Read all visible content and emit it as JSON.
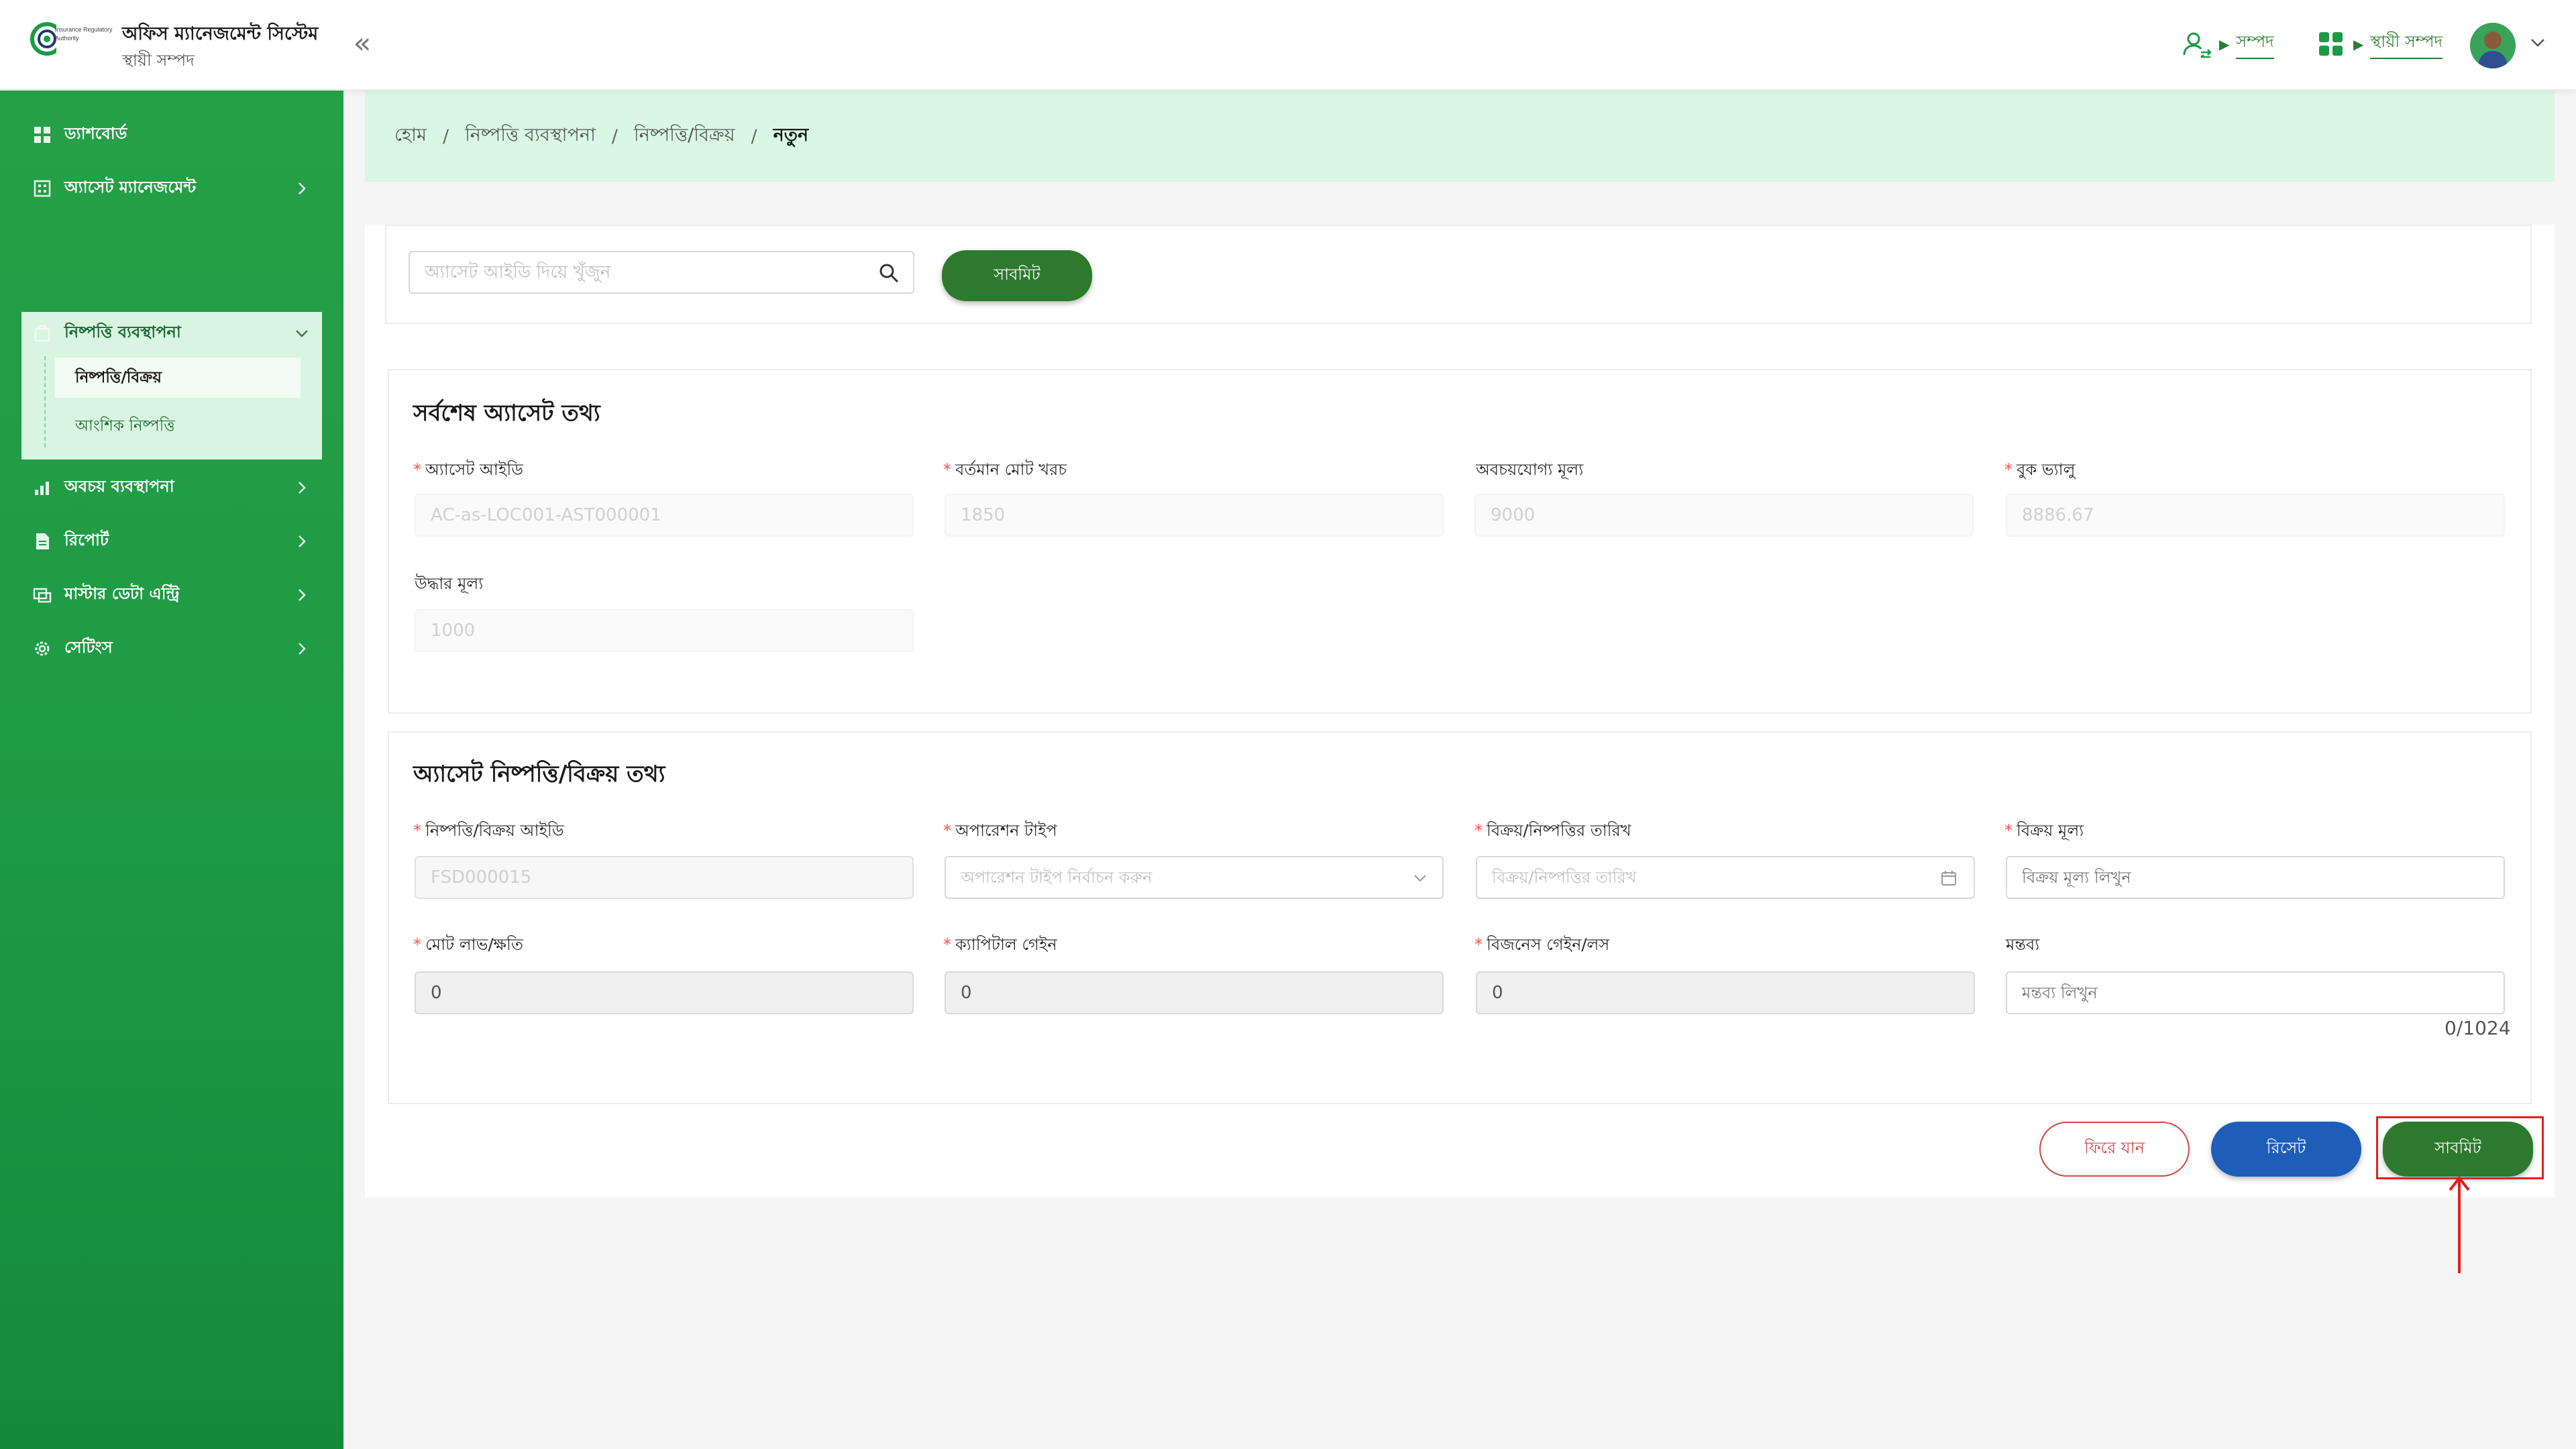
{
  "header": {
    "logo_text": "Insurance Regulatory Authority",
    "app_title": "অফিস ম্যানেজমেন্ট সিস্টেম",
    "app_subtitle": "স্থায়ী সম্পদ",
    "collapse_glyph": "«",
    "link1_label": "সম্পদ",
    "link2_label": "স্থায়ী সম্পদ",
    "link1_icon": "user-switch-icon",
    "link2_icon": "apps-grid-icon"
  },
  "sidebar": {
    "items": [
      {
        "label": "ড্যাশবোর্ড",
        "icon": "dashboard-icon"
      },
      {
        "label": "অ্যাসেট ম্যানেজমেন্ট",
        "icon": "building-icon"
      },
      {
        "label": "নিষ্পত্তি ব্যবস্থাপনা",
        "icon": "disposal-icon"
      },
      {
        "label": "অবচয় ব্যবস্থাপনা",
        "icon": "depreciation-icon"
      },
      {
        "label": "রিপোর্ট",
        "icon": "report-icon"
      },
      {
        "label": "মাস্টার ডেটা এন্ট্রি",
        "icon": "master-data-icon"
      },
      {
        "label": "সেটিংস",
        "icon": "settings-icon"
      }
    ],
    "sub_items": [
      {
        "label": "নিষ্পত্তি/বিক্রয়"
      },
      {
        "label": "আংশিক নিষ্পত্তি"
      }
    ]
  },
  "breadcrumb": {
    "items": [
      "হোম",
      "নিষ্পত্তি ব্যবস্থাপনা",
      "নিষ্পত্তি/বিক্রয়"
    ],
    "current": "নতুন",
    "separator": "/"
  },
  "search": {
    "placeholder": "অ্যাসেট আইডি দিয়ে খুঁজুন",
    "submit_label": "সাবমিট"
  },
  "latest_asset": {
    "title": "সর্বশেষ অ্যাসেট তথ্য",
    "fields": [
      {
        "label": "অ্যাসেট আইডি",
        "required": true,
        "value": "AC-as-LOC001-AST000001"
      },
      {
        "label": "বর্তমান মোট খরচ",
        "required": true,
        "value": "1850"
      },
      {
        "label": "অবচয়যোগ্য মূল্য",
        "required": false,
        "value": "9000"
      },
      {
        "label": "বুক ভ্যালু",
        "required": true,
        "value": "8886.67"
      },
      {
        "label": "উদ্ধার মূল্য",
        "required": false,
        "value": "1000"
      }
    ]
  },
  "disposal": {
    "title": "অ্যাসেট নিষ্পত্তি/বিক্রয় তথ্য",
    "disposal_id": {
      "label": "নিষ্পত্তি/বিক্রয় আইডি",
      "required": true,
      "value": "FSD000015"
    },
    "operation_type": {
      "label": "অপারেশন টাইপ",
      "required": true,
      "placeholder": "অপারেশন টাইপ নির্বাচন করুন"
    },
    "date": {
      "label": "বিক্রয়/নিষ্পত্তির তারিখ",
      "required": true,
      "placeholder": "বিক্রয়/নিষ্পত্তির তারিখ"
    },
    "sale_price": {
      "label": "বিক্রয় মূল্য",
      "required": true,
      "placeholder": "বিক্রয় মূল্য লিখুন"
    },
    "total_profit_loss": {
      "label": "মোট লাভ/ক্ষতি",
      "required": true,
      "value": "0"
    },
    "capital_gain": {
      "label": "ক্যাপিটাল গেইন",
      "required": true,
      "value": "0"
    },
    "business_gain_loss": {
      "label": "বিজনেস গেইন/লস",
      "required": true,
      "value": "0"
    },
    "comment": {
      "label": "মন্তব্য",
      "required": false,
      "placeholder": "মন্তব্য লিখুন",
      "counter": "0/1024"
    }
  },
  "actions": {
    "back_label": "ফিরে যান",
    "reset_label": "রিসেট",
    "submit_label": "সাবমিট"
  },
  "colors": {
    "primary_green": "#2d7a2e",
    "sidebar_green": "#1d9a45",
    "breadcrumb_bg": "#d9f7e3",
    "reset_blue": "#1e5eb8",
    "back_red": "#d64545",
    "highlight_red": "#e02020"
  }
}
